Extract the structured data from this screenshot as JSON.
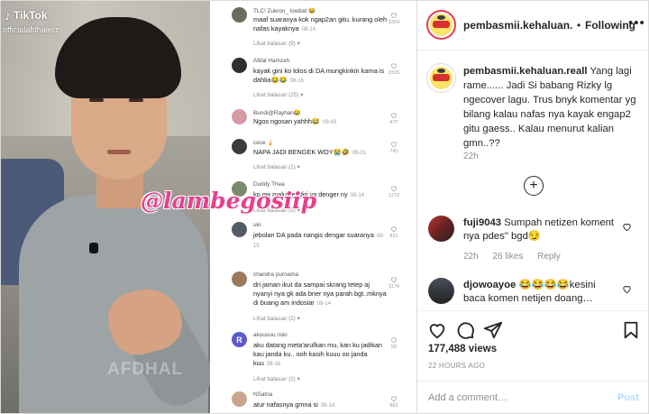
{
  "media": {
    "tiktok_brand": "TikTok",
    "tiktok_user": "officialafdhalerz",
    "video_watermark": "AFDHAL",
    "stamp": "@lambegosiip"
  },
  "tiktok_comments": [
    {
      "name": "TLC! Zukron_ lowbat 😂",
      "text": "maaf suaranya kok ngap2an gitu. kurang oleh nafas kayaknya",
      "date": "08-14",
      "replies": "Lihat balasan (9) ▾",
      "likes": "3304",
      "avatar_color": "#6d6a5e"
    },
    {
      "name": "Afdal Hamzah",
      "text": "kayak gini ko lolos di DA mungkinkin karna is dahlia😂😂",
      "date": "08-15",
      "replies": "Lihat balasan (25) ▾",
      "likes": "2315",
      "avatar_color": "#2f2f2f"
    },
    {
      "name": "Bundi@Rayhan😂",
      "text": "Ngos ngosan yahhh😂",
      "date": "09-03",
      "replies": "",
      "likes": "477",
      "avatar_color": "#d59aa1"
    },
    {
      "name": "cece 🍦",
      "text": "NAPA JADI BENGEK WOY😭🤣",
      "date": "09-01",
      "replies": "Lihat balasan (1) ▾",
      "likes": "741",
      "avatar_color": "#3c3c3c"
    },
    {
      "name": "Duddy Thea",
      "text": "ko gw malu sendiri ya denger ny",
      "date": "08-14",
      "replies": "Lihat balasan (5) ▾",
      "likes": "1272",
      "avatar_color": "#7d8a6a"
    },
    {
      "name": "uki",
      "text": "jebolan DA pada nangis dengar suaranya",
      "date": "08-15",
      "replies": "",
      "likes": "821",
      "avatar_color": "#555b66"
    },
    {
      "name": "chandra purnama",
      "text": "dri jaman ikut da sampai skrang tetep aj nyanyi nya gk ada bner nya parah bgt..mknya di buang am indosiar",
      "date": "08-14",
      "replies": "Lihat balasan (2) ▾",
      "likes": "1179",
      "avatar_color": "#9a7a5a"
    },
    {
      "name": "akuuuuu riski",
      "letter": "R",
      "text": "aku datang meta'arufkan mu, kan ku jadikan kau janda ku.. ooh kasih kuuu oo janda kuu",
      "date": "09-16",
      "replies": "Lihat balasan (2) ▾",
      "likes": "58",
      "avatar_color": "#5b5bcc"
    },
    {
      "name": "NSatria",
      "text": "atur nafasnya gmna si",
      "date": "08-14",
      "replies": "",
      "likes": "862",
      "avatar_color": "#caa48e"
    }
  ],
  "instagram": {
    "header": {
      "username": "pembasmii.kehaluan.",
      "separator": "•",
      "follow_status": "Following",
      "more": "•••"
    },
    "caption": {
      "username": "pembasmii.kehaluan.reall",
      "text": "Yang lagi rame...... Jadi Si babang Rizky lg ngecover lagu. Trus bnyk komentar yg bilang kalau nafas nya kayak engap2 gitu gaess.. Kalau menurut kalian gmn..??",
      "time": "22h"
    },
    "load_more": "+",
    "comments": [
      {
        "username": "fuji9043",
        "text": "Sumpah netizen koment nya pdes\" bgd😏",
        "time": "22h",
        "likes": "26 likes",
        "reply": "Reply"
      },
      {
        "username": "djowoayoe",
        "text": "😂😂😂😂kesini baca komen netijen doang…",
        "time": "",
        "likes": "",
        "reply": ""
      }
    ],
    "views": "177,488 views",
    "posted": "22 HOURS AGO",
    "add_comment_placeholder": "Add a comment…",
    "post_button": "Post",
    "colors": {
      "link_disabled": "#b3dbff",
      "text": "#262626",
      "muted": "#8e8e8e"
    }
  }
}
